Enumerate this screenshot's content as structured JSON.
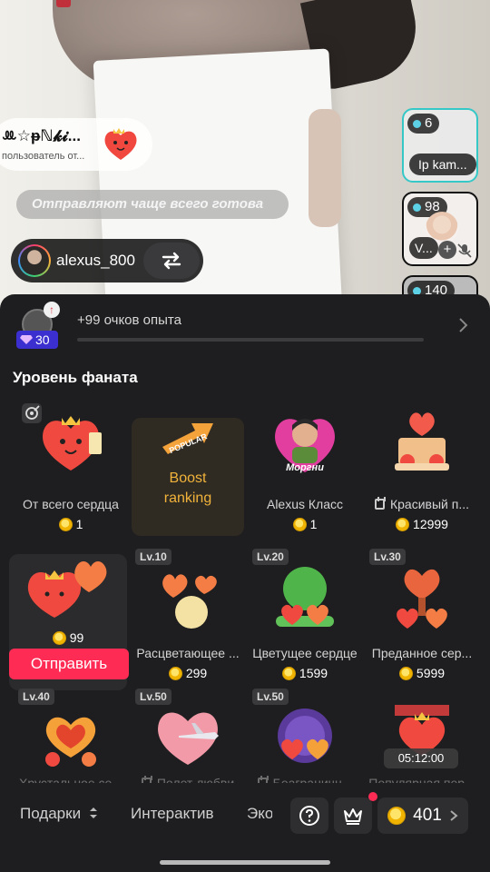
{
  "stream": {
    "top_user": {
      "name": "ꔛ☆ᵽℕ𝓴𝓲...",
      "subtitle": "пользователь от..."
    },
    "message": "Отправляют чаще всего готова",
    "guest": {
      "name": "alexus_800"
    },
    "side_cards": [
      {
        "count": "6",
        "label": "Ip kam..."
      },
      {
        "count": "98",
        "label": "V..."
      },
      {
        "count": "140"
      }
    ]
  },
  "sheet": {
    "level": "30",
    "xp_text": "+99 очков опыта",
    "xp_progress": 0.0,
    "section_title": "Уровень фаната",
    "gifts_row1": [
      {
        "name": "От всего сердца",
        "price": "1"
      },
      {
        "boost_line1": "Boost",
        "boost_line2": "ranking"
      },
      {
        "name": "Alexus Класс",
        "price": "1"
      },
      {
        "name": "Красивый п...",
        "price": "12999"
      }
    ],
    "gifts_row2": [
      {
        "price": "99",
        "send": "Отправить"
      },
      {
        "level": "Lv.10",
        "name": "Расцветающее ...",
        "price": "299"
      },
      {
        "level": "Lv.20",
        "name": "Цветущее сердце",
        "price": "1599"
      },
      {
        "level": "Lv.30",
        "name": "Преданное сер...",
        "price": "5999"
      }
    ],
    "gifts_row3": [
      {
        "level": "Lv.40",
        "name": "Хрустальное се..."
      },
      {
        "level": "Lv.50",
        "name": "Полет любви"
      },
      {
        "level": "Lv.50",
        "name": "Беаграничн..."
      },
      {
        "name": "Популярная пер...",
        "timer": "05:12:00"
      }
    ],
    "morgni_caption": "Моргни",
    "popular_caption": "POPULAR"
  },
  "bottom_bar": {
    "tab_gifts": "Подарки",
    "tab_interactive": "Интерактив",
    "tab_more": "Эко",
    "balance": "401"
  },
  "colors": {
    "accent": "#fe2c55",
    "boost": "#f2b33a",
    "level_badge": "#3b2fcf",
    "coin": "#f0b400"
  }
}
